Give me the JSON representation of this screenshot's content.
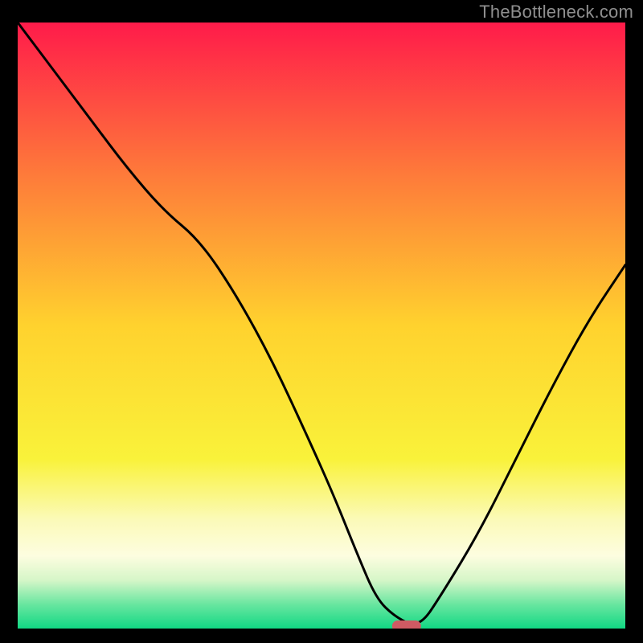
{
  "watermark": "TheBottleneck.com",
  "chart_data": {
    "type": "line",
    "title": "",
    "xlabel": "",
    "ylabel": "",
    "xlim": [
      0,
      100
    ],
    "ylim": [
      0,
      100
    ],
    "x": [
      0,
      6,
      12,
      18,
      24,
      30,
      36,
      42,
      48,
      52,
      56,
      59,
      62,
      66,
      70,
      76,
      82,
      88,
      94,
      100
    ],
    "values": [
      100,
      92,
      84,
      76,
      69,
      64,
      55,
      44,
      31,
      22,
      12,
      5,
      2,
      0,
      6,
      16,
      28,
      40,
      51,
      60
    ],
    "series": [
      {
        "name": "bottleneck-curve",
        "x": [
          0,
          6,
          12,
          18,
          24,
          30,
          36,
          42,
          48,
          52,
          56,
          59,
          62,
          66,
          70,
          76,
          82,
          88,
          94,
          100
        ],
        "values": [
          100,
          92,
          84,
          76,
          69,
          64,
          55,
          44,
          31,
          22,
          12,
          5,
          2,
          0,
          6,
          16,
          28,
          40,
          51,
          60
        ]
      }
    ],
    "marker": {
      "x": 64,
      "y": 0,
      "color": "#cf5a63"
    },
    "gradient_stops": [
      {
        "offset": 0.0,
        "color": "#ff1b4a"
      },
      {
        "offset": 0.25,
        "color": "#fe7a3a"
      },
      {
        "offset": 0.5,
        "color": "#ffd22e"
      },
      {
        "offset": 0.72,
        "color": "#f9f23a"
      },
      {
        "offset": 0.82,
        "color": "#fbfab8"
      },
      {
        "offset": 0.88,
        "color": "#fdfde0"
      },
      {
        "offset": 0.92,
        "color": "#d6f6c8"
      },
      {
        "offset": 0.96,
        "color": "#69e6a0"
      },
      {
        "offset": 1.0,
        "color": "#11d884"
      }
    ]
  }
}
